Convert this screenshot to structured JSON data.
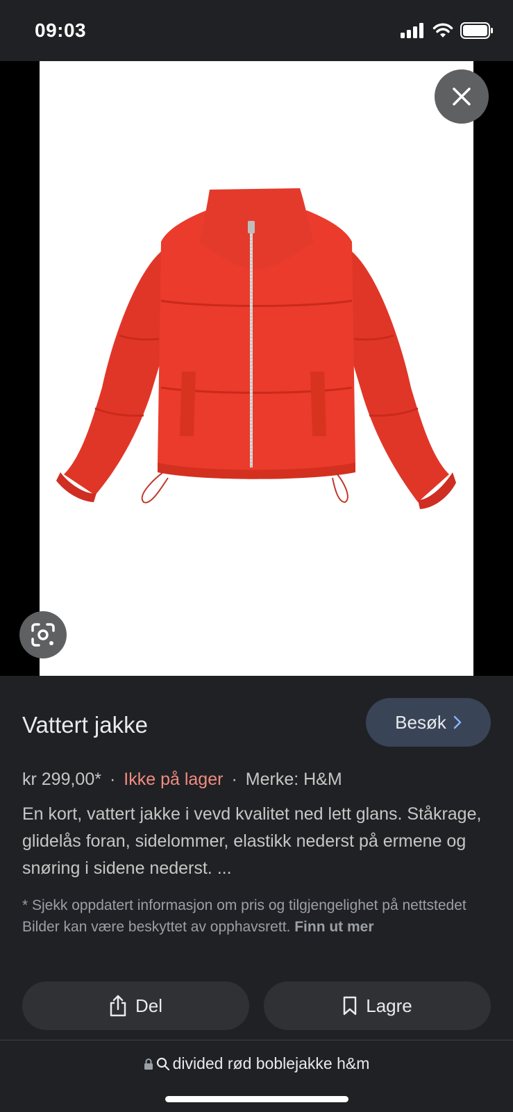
{
  "status": {
    "time": "09:03"
  },
  "product": {
    "title": "Vattert jakke",
    "visit_label": "Besøk",
    "price": "kr 299,00*",
    "stock": "Ikke på lager",
    "brand": "Merke: H&M",
    "description": "En kort, vattert jakke i vevd kvalitet ned lett glans. Ståkrage, glidelås foran, sidelommer, elastikk nederst på ermene og snøring i sidene nederst. ...",
    "disclaimer": "* Sjekk oppdatert informasjon om pris og tilgjengelighet på nettstedet Bilder kan være beskyttet av opphavsrett.",
    "disclaimer_link": "Finn ut mer"
  },
  "actions": {
    "share_label": "Del",
    "save_label": "Lagre"
  },
  "browser": {
    "url": "divided rød boblejakke h&m"
  },
  "colors": {
    "jacket": "#e8342a",
    "background": "#202124",
    "stock": "#f28b82",
    "visit_button": "#394457"
  }
}
